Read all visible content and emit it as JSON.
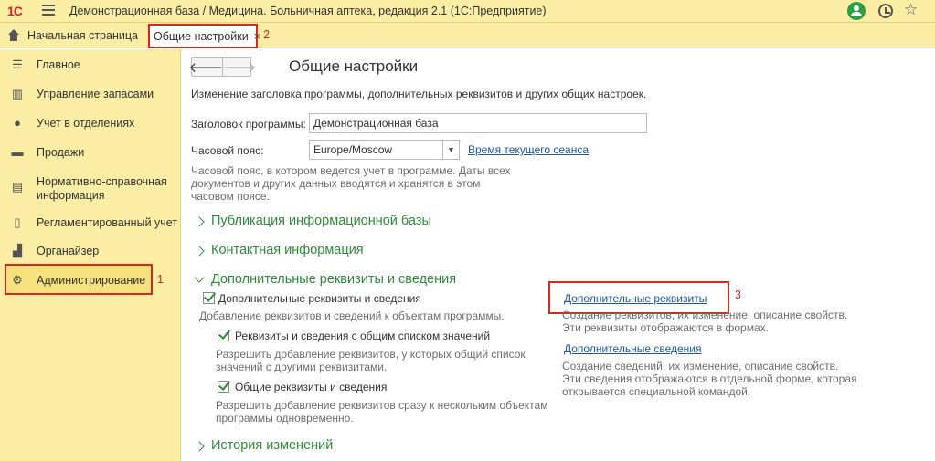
{
  "titlebar": {
    "logo": "1С",
    "title": "Демонстрационная база / Медицина. Больничная аптека, редакция 2.1  (1С:Предприятие)",
    "icons": [
      "hamburger-icon",
      "user-icon",
      "history-icon",
      "star-icon"
    ]
  },
  "tabs": {
    "home_label": "Начальная страница",
    "settings_label": "Общие настройки",
    "close_glyph": "×",
    "callout_2": "2"
  },
  "sidebar": {
    "items": [
      {
        "label": "Главное",
        "icon": "list-icon"
      },
      {
        "label": "Управление запасами",
        "icon": "warehouse-icon"
      },
      {
        "label": "Учет в отделениях",
        "icon": "person-icon"
      },
      {
        "label": "Продажи",
        "icon": "cart-icon"
      },
      {
        "label": "Нормативно-справочная",
        "label2": "информация",
        "icon": "books-icon"
      },
      {
        "label": "Регламентированный учет",
        "icon": "document-icon"
      },
      {
        "label": "Органайзер",
        "icon": "chart-icon"
      },
      {
        "label": "Администрирование",
        "icon": "gear-icon"
      }
    ],
    "callout_1": "1"
  },
  "main": {
    "back_glyph": "🡐",
    "forward_glyph": "🡒",
    "title": "Общие настройки",
    "description": "Изменение заголовка программы, дополнительных реквизитов и других общих настроек.",
    "program_title_label": "Заголовок программы:",
    "program_title_value": "Демонстрационная база",
    "timezone_label": "Часовой пояс:",
    "timezone_value": "Europe/Moscow",
    "timezone_link": "Время текущего сеанса",
    "timezone_hint_1": "Часовой пояс, в котором ведется учет в программе. Даты всех",
    "timezone_hint_2": "документов и других данных вводятся и хранятся в этом",
    "timezone_hint_3": "часовом поясе.",
    "section_publication": "Публикация информационной базы",
    "section_contact": "Контактная информация",
    "section_additional": "Дополнительные реквизиты и сведения",
    "cb_additional": "Дополнительные реквизиты и сведения",
    "cb_additional_hint": "Добавление реквизитов и сведений к объектам программы.",
    "cb_shared_list": "Реквизиты и сведения с общим списком значений",
    "cb_shared_list_hint_1": "Разрешить добавление реквизитов, у которых общий список",
    "cb_shared_list_hint_2": "значений с другими реквизитами.",
    "cb_common": "Общие реквизиты и сведения",
    "cb_common_hint_1": "Разрешить добавление реквизитов сразу к нескольким объектам",
    "cb_common_hint_2": "программы одновременно.",
    "link_additional_props": "Дополнительные реквизиты",
    "props_hint_1": "Создание реквизитов, их изменение, описание свойств.",
    "props_hint_2": "Эти реквизиты отображаются в формах.",
    "link_additional_info": "Дополнительные сведения",
    "info_hint_1": "Создание сведений, их изменение, описание свойств.",
    "info_hint_2": "Эти сведения отображаются в отдельной форме, которая",
    "info_hint_3": "открывается специальной командой.",
    "section_history": "История изменений",
    "callout_3": "3"
  },
  "colors": {
    "accent_yellow": "#fbeda4",
    "section_green": "#2e8b3a",
    "link_blue": "#1a5ba8",
    "callout_red": "#d9271f"
  }
}
